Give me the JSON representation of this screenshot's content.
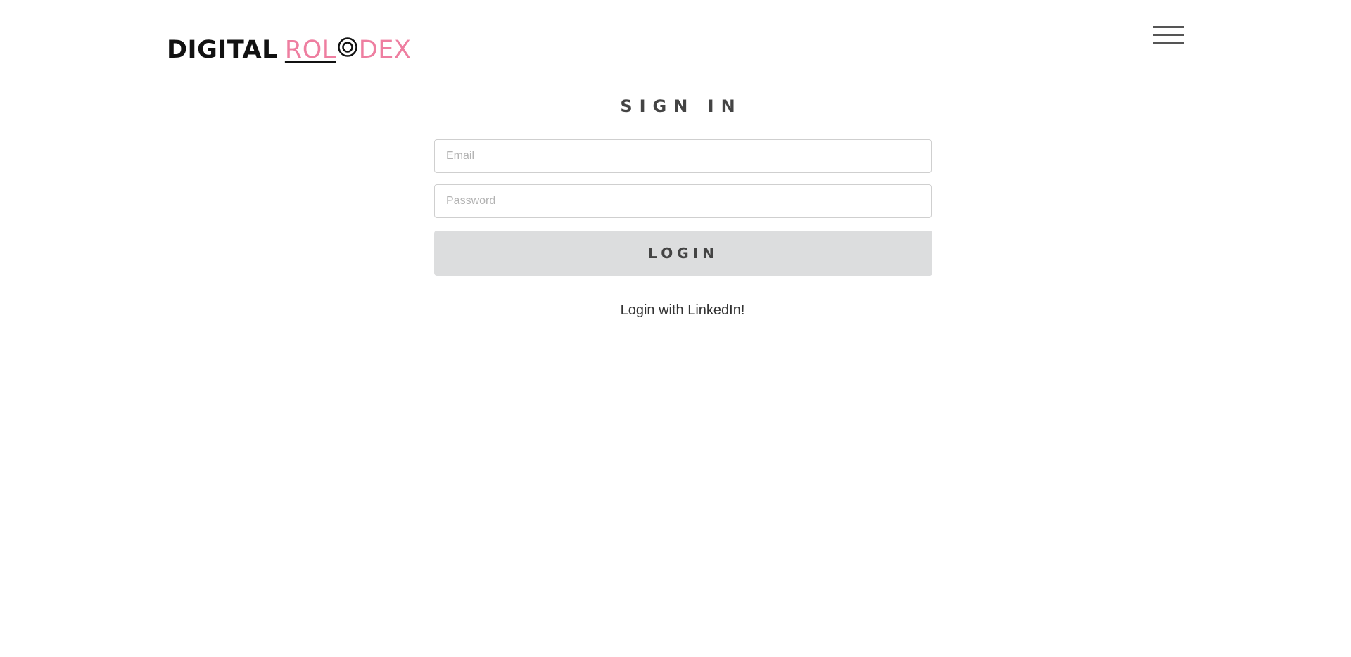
{
  "header": {
    "logo": {
      "part_a": "DIGITAL",
      "part_b": "ROL",
      "part_c": "DEX",
      "accent_color": "#ee7ea0"
    },
    "menu_icon": "hamburger-menu-icon"
  },
  "signin": {
    "title": "SIGN IN",
    "email_placeholder": "Email",
    "password_placeholder": "Password",
    "login_label": "LOGIN",
    "linkedin_label": "Login with LinkedIn!"
  }
}
